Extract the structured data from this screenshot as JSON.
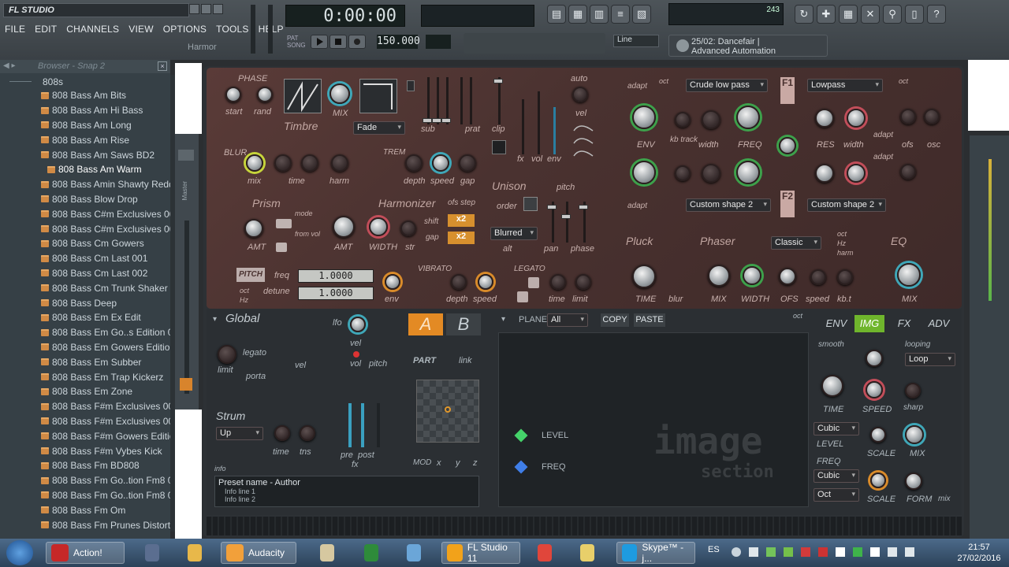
{
  "app": {
    "logo": "FL STUDIO",
    "hint_label": "Harmor"
  },
  "menu": [
    "FILE",
    "EDIT",
    "CHANNELS",
    "VIEW",
    "OPTIONS",
    "TOOLS",
    "HELP"
  ],
  "transport": {
    "time": "0:00:00",
    "tempo": "150.000",
    "tempo_label": "TEMPO",
    "pat": "PAT",
    "song": "SONG",
    "pat_label": "PAT",
    "line_mode": "Line",
    "step_label": "STEP",
    "cpu": "243"
  },
  "hint_panel": {
    "line1": "25/02: Dancefair |",
    "line2": "Advanced Automation"
  },
  "browser": {
    "title": "Browser - Snap 2",
    "folder": "808s",
    "items": [
      "808 Bass Am Bits",
      "808 Bass Am Hi Bass",
      "808 Bass Am Long",
      "808 Bass Am Rise",
      "808 Bass Am Saws BD2",
      "808 Bass Am Warm",
      "808 Bass Amin Shawty Redd",
      "808 Bass Blow Drop",
      "808 Bass C#m Exclusives 003",
      "808 Bass C#m Exclusives 004",
      "808 Bass Cm Gowers",
      "808 Bass Cm Last 001",
      "808 Bass Cm Last 002",
      "808 Bass Cm Trunk Shaker",
      "808 Bass Deep",
      "808 Bass Em Ex Edit",
      "808 Bass Em Go..s Edition 002",
      "808 Bass Em Gowers Edition",
      "808 Bass Em Subber",
      "808 Bass Em Trap Kickerz",
      "808 Bass Em Zone",
      "808 Bass F#m Exclusives 001",
      "808 Bass F#m Exclusives 002",
      "808 Bass F#m Gowers Edition",
      "808 Bass F#m Vybes Kick",
      "808 Bass Fm BD808",
      "808 Bass Fm Go..tion Fm8 001",
      "808 Bass Fm Go..tion Fm8 002",
      "808 Bass Fm Om",
      "808 Bass Fm Prunes Distort"
    ],
    "selected_index": 5
  },
  "mixer_label": "Master",
  "synth": {
    "phase": "PHASE",
    "start": "start",
    "rand": "rand",
    "timbre": "Timbre",
    "mix": "MIX",
    "fade": "Fade",
    "sub": "sub",
    "prat": "prat",
    "clip": "clip",
    "fx": "fx",
    "vol": "vol",
    "env": "env",
    "auto": "auto",
    "vel": "vel",
    "blur": "BLUR",
    "blur_mix": "mix",
    "blur_time": "time",
    "harm": "harm",
    "trem": "TREM",
    "depth": "depth",
    "speed": "speed",
    "gap": "gap",
    "unison": "Unison",
    "order": "order",
    "pitch": "pitch",
    "blurred": "Blurred",
    "alt": "alt",
    "pan": "pan",
    "phase_u": "phase",
    "prism": "Prism",
    "mode": "mode",
    "from_vol": "from vol",
    "amt": "AMT",
    "harmonizer": "Harmonizer",
    "ofs_step": "ofs step",
    "amt2": "AMT",
    "width": "WIDTH",
    "str": "str",
    "shift": "shift",
    "gap2": "gap",
    "x2a": "x2",
    "x2b": "x2",
    "pitch_btn": "PITCH",
    "freq": "freq",
    "detune": "detune",
    "freq_val": "1.0000",
    "detune_val": "1.0000",
    "oct": "oct",
    "hz": "Hz",
    "env2": "env",
    "vibrato": "VIBRATO",
    "depth2": "depth",
    "speed2": "speed",
    "legato": "LEGATO",
    "time": "time",
    "limit": "limit",
    "adapt": "adapt",
    "oct_hz": "oct",
    "filter1": "Crude low pass",
    "filter2": "Lowpass",
    "f1": "F1",
    "env_lbl": "ENV",
    "kb_track": "kb track",
    "width_f": "width",
    "freq_f": "FREQ",
    "res": "RES",
    "width_r": "width",
    "adapt2": "adapt",
    "ofs": "ofs",
    "osc": "osc",
    "adapt3": "adapt",
    "shape2a": "Custom shape 2",
    "shape2b": "Custom shape 2",
    "f2": "F2",
    "pluck": "Pluck",
    "time_p": "TIME",
    "blur_p": "blur",
    "phaser": "Phaser",
    "classic": "Classic",
    "mix_p": "MIX",
    "width_p": "WIDTH",
    "ofs_p": "OFS",
    "speed_p": "speed",
    "kbt": "kb.t",
    "oct_p": "oct",
    "hz_p": "Hz",
    "harm_p": "harm",
    "eq": "EQ",
    "mix_eq": "MIX"
  },
  "lower": {
    "global": "Global",
    "lfo": "lfo",
    "legato": "legato",
    "limit": "limit",
    "vel": "vel",
    "porta": "porta",
    "vel2": "vel",
    "vol": "vol",
    "pitch": "pitch",
    "strum": "Strum",
    "strum_val": "Up",
    "time": "time",
    "tns": "tns",
    "pre": "pre",
    "post": "post",
    "fx": "fx",
    "a": "A",
    "b": "B",
    "part": "PART",
    "link": "link",
    "mod": "MOD",
    "mx": "x",
    "my": "y",
    "mz": "z",
    "info": "info",
    "preset": "Preset name - Author",
    "info1": "Info line 1",
    "info2": "Info line 2",
    "plane": "PLANE",
    "plane_val": "All",
    "copy": "COPY",
    "paste": "PASTE",
    "level": "LEVEL",
    "freq": "FREQ",
    "image": "image",
    "section": "section",
    "tabs": [
      "ENV",
      "IMG",
      "FX",
      "ADV"
    ],
    "active_tab": "IMG",
    "smooth": "smooth",
    "looping": "looping",
    "loop": "Loop",
    "time_k": "TIME",
    "speed_k": "SPEED",
    "sharp": "sharp",
    "cubic1": "Cubic",
    "level_k": "LEVEL",
    "scale1": "SCALE",
    "mix_k": "MIX",
    "freq_k": "FREQ",
    "cubic2": "Cubic",
    "oct": "Oct",
    "scale2": "SCALE",
    "form": "FORM",
    "mix2": "mix",
    "oct_hz": "oct"
  },
  "taskbar": {
    "items": [
      {
        "label": "Action!",
        "icon": "record-icon"
      },
      {
        "label": "",
        "icon": "media-icon"
      },
      {
        "label": "",
        "icon": "paint-icon"
      },
      {
        "label": "Audacity",
        "icon": "audacity-icon"
      },
      {
        "label": "",
        "icon": "folder-icon"
      },
      {
        "label": "",
        "icon": "excel-icon"
      },
      {
        "label": "",
        "icon": "calculator-icon"
      },
      {
        "label": "FL Studio 11",
        "icon": "fl-studio-icon"
      },
      {
        "label": "",
        "icon": "chrome-icon"
      },
      {
        "label": "",
        "icon": "explorer-icon"
      },
      {
        "label": "Skype™ - j...",
        "icon": "skype-icon"
      }
    ],
    "lang": "ES",
    "time": "21:57",
    "date": "27/02/2016"
  }
}
